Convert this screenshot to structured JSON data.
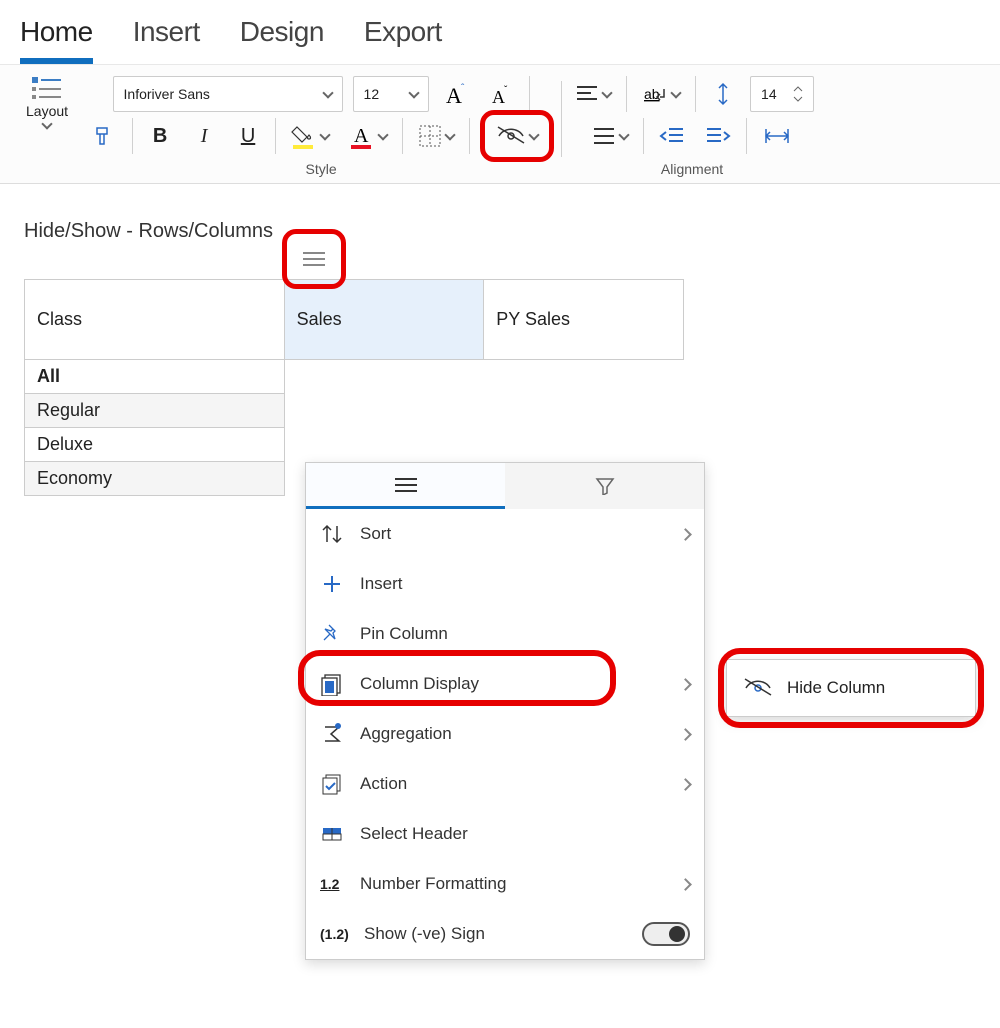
{
  "tabs": [
    "Home",
    "Insert",
    "Design",
    "Export"
  ],
  "active_tab_index": 0,
  "ribbon": {
    "layout_label": "Layout",
    "font_family": "Inforiver Sans",
    "font_size": "12",
    "line_spacing": "14",
    "group_style_label": "Style",
    "group_alignment_label": "Alignment"
  },
  "section_title": "Hide/Show - Rows/Columns",
  "table": {
    "headers": [
      "Class",
      "Sales",
      "PY Sales"
    ],
    "rows": [
      {
        "label": "All",
        "bold": true
      },
      {
        "label": "Regular"
      },
      {
        "label": "Deluxe"
      },
      {
        "label": "Economy"
      }
    ]
  },
  "context_menu": {
    "items": [
      {
        "icon": "sort-icon",
        "label": "Sort",
        "arrow": true
      },
      {
        "icon": "plus-icon",
        "label": "Insert",
        "arrow": false
      },
      {
        "icon": "pin-icon",
        "label": "Pin Column",
        "arrow": false
      },
      {
        "icon": "column-display-icon",
        "label": "Column Display",
        "arrow": true
      },
      {
        "icon": "aggregation-icon",
        "label": "Aggregation",
        "arrow": true
      },
      {
        "icon": "action-icon",
        "label": "Action",
        "arrow": true
      },
      {
        "icon": "select-header-icon",
        "label": "Select Header",
        "arrow": false
      },
      {
        "icon": "number-format-icon",
        "label": "Number Formatting",
        "arrow": true
      },
      {
        "icon": "negative-sign-icon",
        "label": "Show (-ve) Sign",
        "toggle": true
      }
    ]
  },
  "hide_column_label": "Hide Column"
}
